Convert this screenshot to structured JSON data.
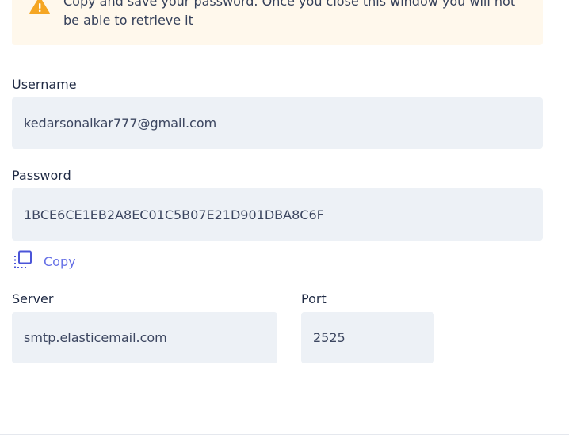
{
  "warning": {
    "icon": "warning-triangle-icon",
    "text": "Copy and save your password. Once you close this window you will not be able to retrieve it",
    "color": "#f5a623"
  },
  "username": {
    "label": "Username",
    "value": "kedarsonalkar777@gmail.com"
  },
  "password": {
    "label": "Password",
    "value": "1BCE6CE1EB2A8EC01C5B07E21D901DBA8C6F"
  },
  "copy": {
    "icon": "copy-icon",
    "label": "Copy",
    "color": "#6670e6"
  },
  "server": {
    "label": "Server",
    "value": "smtp.elasticemail.com"
  },
  "port": {
    "label": "Port",
    "value": "2525"
  }
}
